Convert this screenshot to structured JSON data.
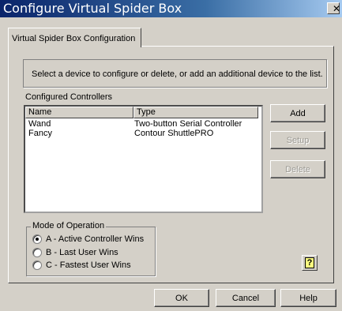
{
  "window": {
    "title": "Configure Virtual Spider Box",
    "close_glyph": "✕"
  },
  "tabs": [
    {
      "label": "Virtual Spider Box Configuration",
      "selected": true
    }
  ],
  "instructions": "Select a device to configure or delete, or add an additional device to the list.",
  "controllers": {
    "label": "Configured Controllers",
    "columns": [
      "Name",
      "Type"
    ],
    "rows": [
      {
        "name": "Wand",
        "type": "Two-button Serial Controller"
      },
      {
        "name": "Fancy",
        "type": "Contour ShuttlePRO"
      }
    ]
  },
  "side_buttons": {
    "add": "Add",
    "setup": "Setup",
    "delete": "Delete"
  },
  "mode": {
    "legend": "Mode of Operation",
    "options": [
      {
        "label": "A - Active Controller Wins",
        "selected": true
      },
      {
        "label": "B - Last User Wins",
        "selected": false
      },
      {
        "label": "C - Fastest User Wins",
        "selected": false
      }
    ]
  },
  "help_icon": "?",
  "footer": {
    "ok": "OK",
    "cancel": "Cancel",
    "help": "Help"
  },
  "colors": {
    "title_gradient_start": "#0a246a",
    "title_gradient_end": "#a6caf0",
    "face": "#d4d0c8"
  }
}
